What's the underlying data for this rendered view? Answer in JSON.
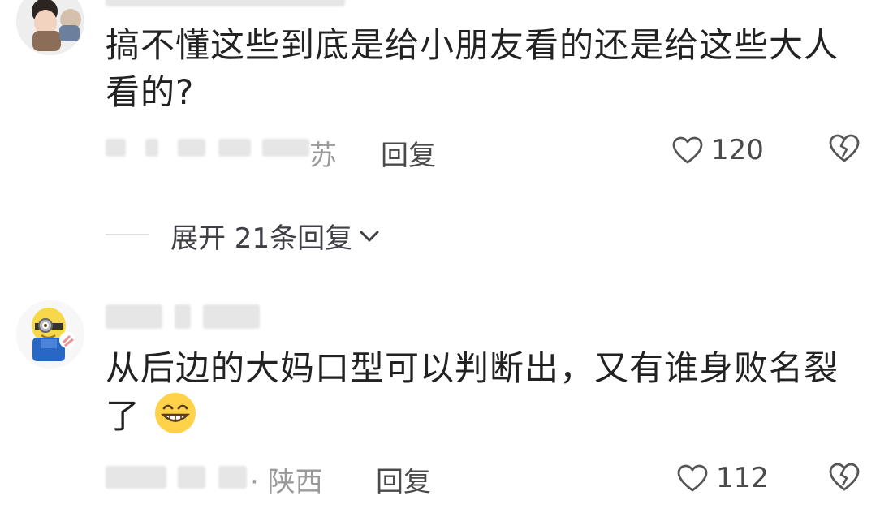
{
  "comments": [
    {
      "text": "搞不懂这些到底是给小朋友看的还是给这些大人看的?",
      "location_visible": "苏",
      "reply_label": "回复",
      "likes": "120",
      "like_icon": "heart-outline-icon",
      "dislike_icon": "broken-heart-icon"
    },
    {
      "text": "从后边的大妈口型可以判断出，又有谁身败名裂了",
      "emoji": "grinning-face-emoji",
      "location_visible": "· 陕西",
      "reply_label": "回复",
      "likes": "112",
      "like_icon": "heart-outline-icon",
      "dislike_icon": "broken-heart-icon"
    }
  ],
  "expand_replies": {
    "label": "展开 21条回复",
    "icon": "chevron-down-icon"
  },
  "colors": {
    "text": "#222222",
    "muted": "#9a9a9a",
    "divider": "#e1e1e1",
    "emoji_yellow": "#ffd24a"
  }
}
